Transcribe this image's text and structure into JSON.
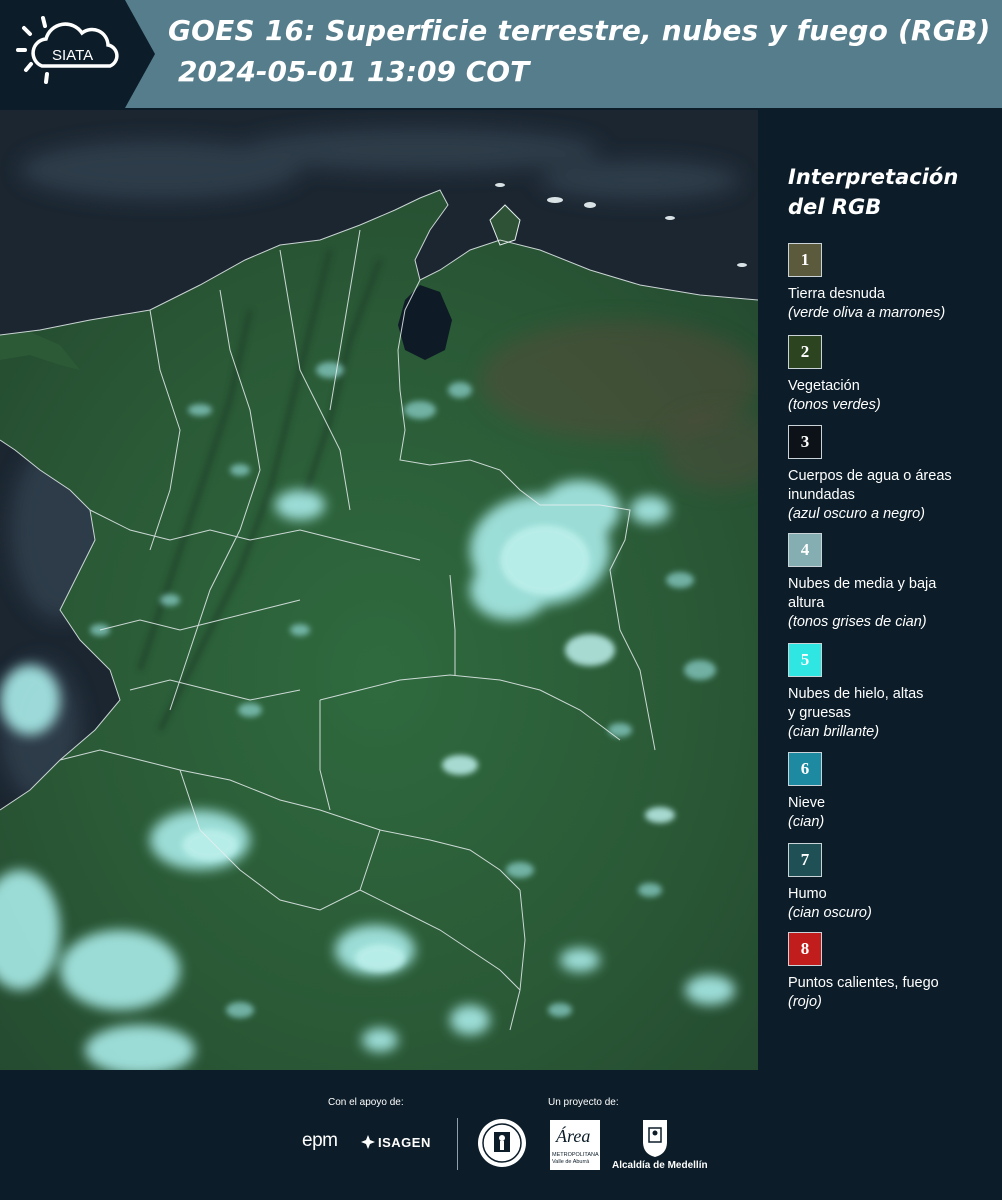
{
  "header": {
    "logo_text": "SIATA",
    "title": "GOES 16: Superficie terrestre, nubes y fuego (RGB)",
    "datetime": "2024-05-01 13:09 COT"
  },
  "legend": {
    "title": "Interpretación del RGB",
    "items": [
      {
        "number": "1",
        "label": "Tierra desnuda",
        "sub": "(verde oliva a marrones)",
        "color": "#5b5a3c"
      },
      {
        "number": "2",
        "label": "Vegetación",
        "sub": "(tonos verdes)",
        "color": "#2c4420"
      },
      {
        "number": "3",
        "label": "Cuerpos de agua o áreas inundadas",
        "sub": "(azul oscuro a negro)",
        "color": "#0d1218"
      },
      {
        "number": "4",
        "label": "Nubes de media y baja altura",
        "sub": "(tonos grises de cian)",
        "color": "#85aeb2"
      },
      {
        "number": "5",
        "label": "Nubes de hielo, altas y gruesas",
        "sub": "(cian brillante)",
        "color": "#2fe6e3"
      },
      {
        "number": "6",
        "label": "Nieve",
        "sub": "(cian)",
        "color": "#1d8aa2"
      },
      {
        "number": "7",
        "label": "Humo",
        "sub": "(cian oscuro)",
        "color": "#1e5055"
      },
      {
        "number": "8",
        "label": "Puntos calientes, fuego",
        "sub": "(rojo)",
        "color": "#c21d1d"
      }
    ]
  },
  "footer": {
    "support_label": "Con el apoyo de:",
    "project_label": "Un proyecto de:",
    "sponsor_1": "epm",
    "sponsor_2": "ISAGEN",
    "partner_area_word": "Área",
    "partner_area_sub": "METROPOLITANA Valle de Aburrá",
    "partner_medellin": "Alcaldía de Medellín"
  },
  "colors": {
    "header_bg": "#567d8c",
    "panel_bg": "#0c1d29",
    "ocean": "#1a2530",
    "vegetation": "#2a5a38",
    "cloud": "#9fe8e6"
  }
}
